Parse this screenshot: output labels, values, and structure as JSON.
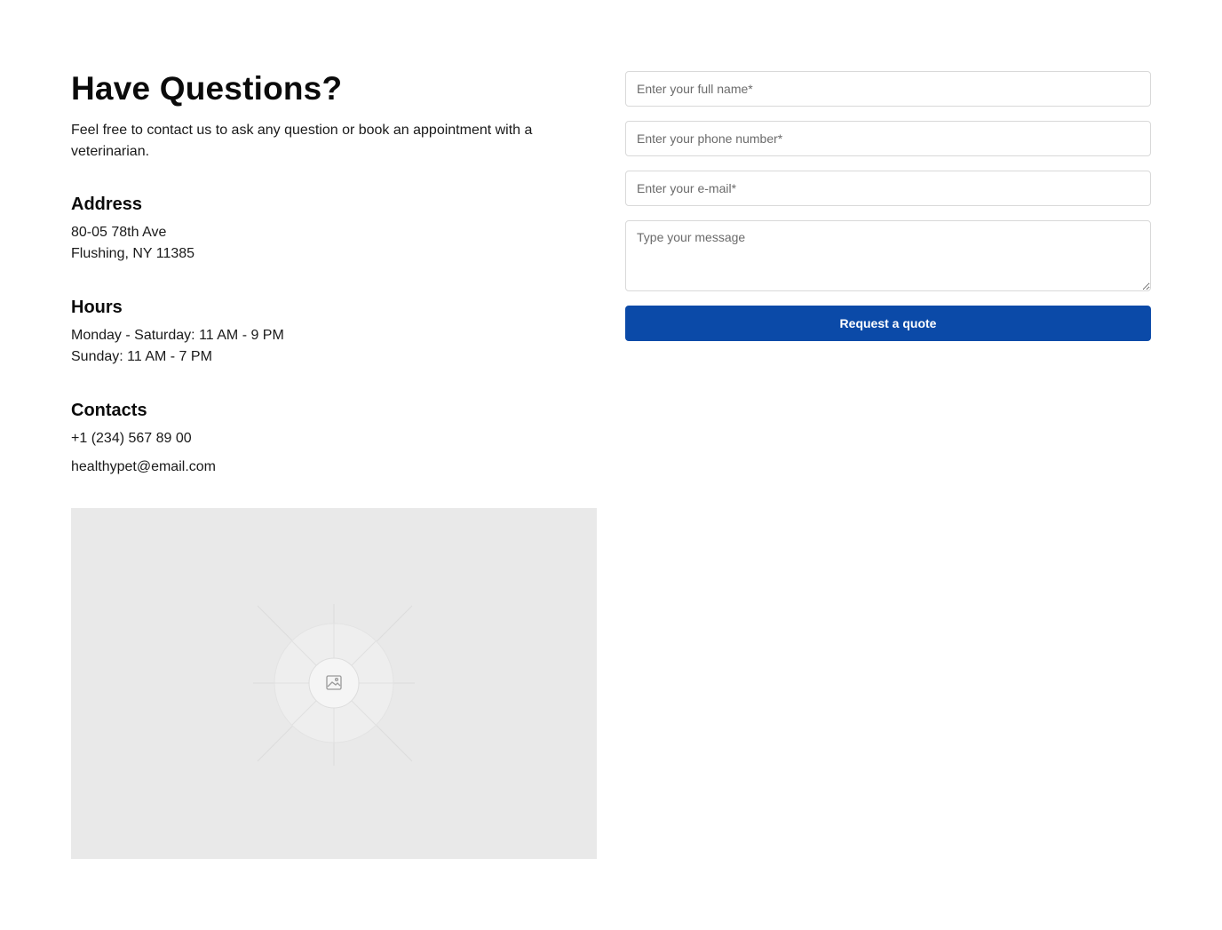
{
  "contact": {
    "title": "Have Questions?",
    "intro": "Feel free to contact us to ask any question or book an appointment with a veterinarian.",
    "address": {
      "heading": "Address",
      "line1": "80-05 78th Ave",
      "line2": "Flushing, NY 11385"
    },
    "hours": {
      "heading": "Hours",
      "line1": "Monday - Saturday: 11 AM - 9 PM",
      "line2": "Sunday: 11 AM - 7 PM"
    },
    "contacts": {
      "heading": "Contacts",
      "phone": "+1 (234) 567 89 00",
      "email": "healthypet@email.com"
    },
    "map": {
      "icon": "image-placeholder-icon"
    }
  },
  "form": {
    "name_placeholder": "Enter your full name*",
    "phone_placeholder": "Enter your phone number*",
    "email_placeholder": "Enter your e-mail*",
    "message_placeholder": "Type your message",
    "submit_label": "Request a quote",
    "accent_color": "#0b4aa8"
  }
}
